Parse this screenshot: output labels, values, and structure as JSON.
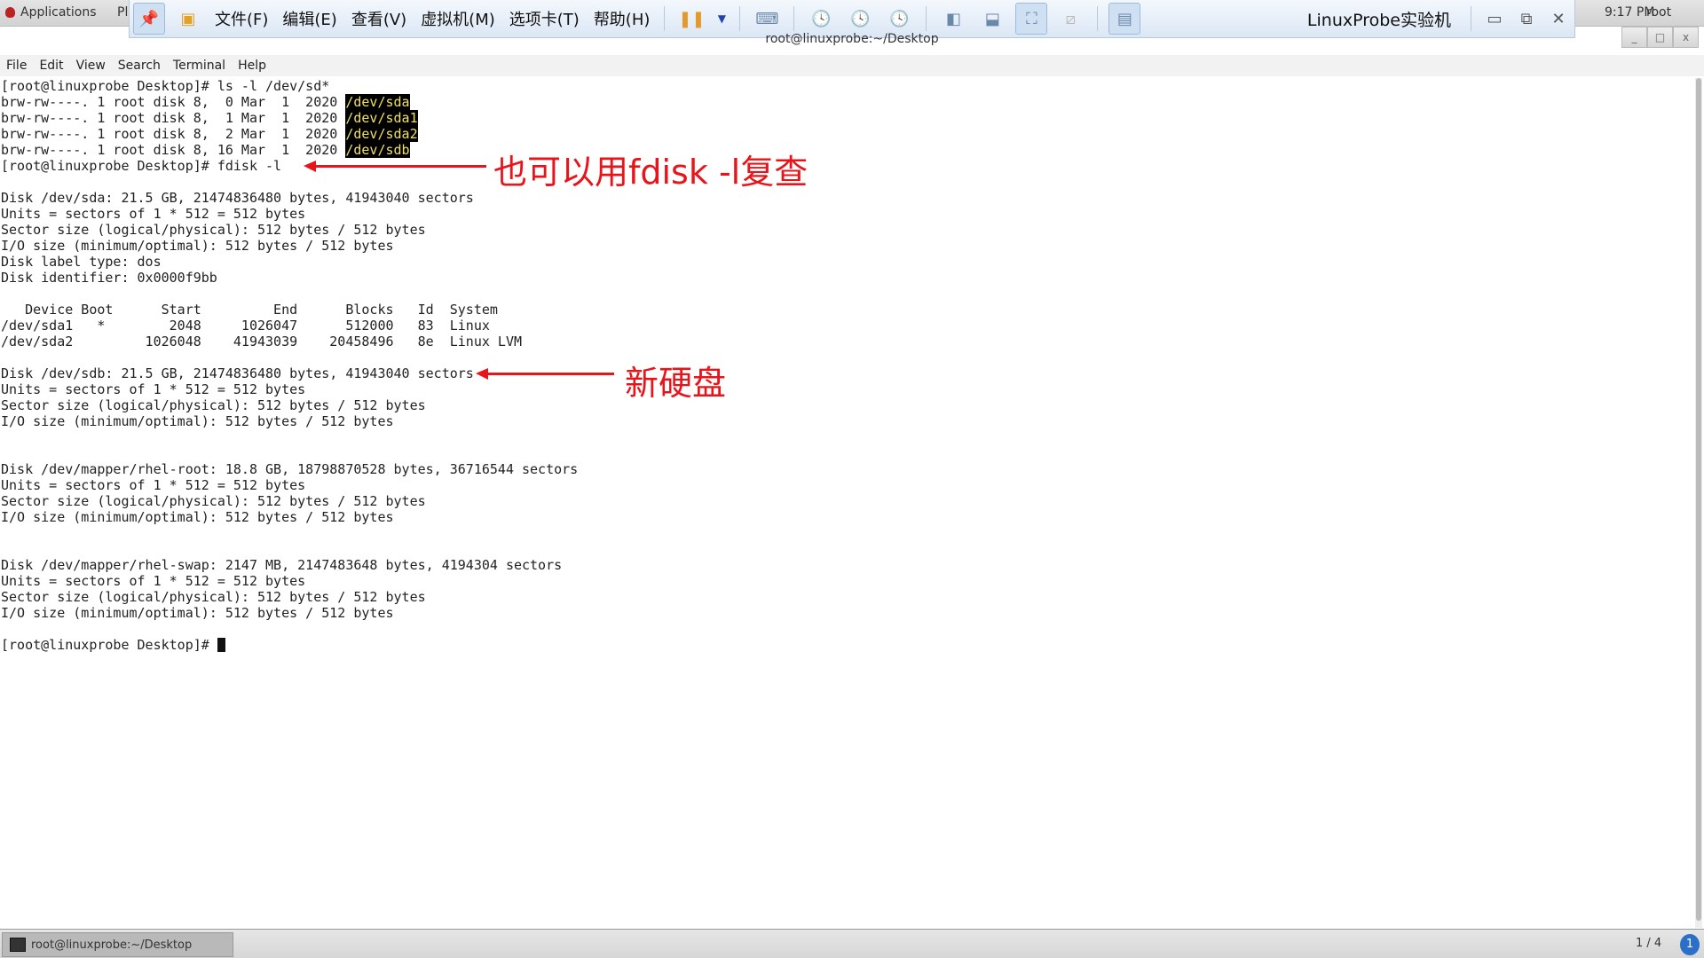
{
  "topbar": {
    "applications": "Applications",
    "places": "Pl",
    "clock": "9:17 PM",
    "user": "root"
  },
  "vmware": {
    "menus": [
      "文件(F)",
      "编辑(E)",
      "查看(V)",
      "虚拟机(M)",
      "选项卡(T)",
      "帮助(H)"
    ],
    "title": "LinuxProbe实验机",
    "icons": [
      "pin-icon",
      "vm-library-icon",
      "pause-icon",
      "dropdown-icon",
      "send-ctrl-alt-del-icon",
      "snapshot-take-icon",
      "snapshot-revert-icon",
      "snapshot-manager-icon",
      "console-view-icon",
      "thumbnail-view-icon",
      "fullscreen-icon",
      "unity-icon",
      "view-toggle-icon"
    ]
  },
  "window": {
    "title": "root@linuxprobe:~/Desktop",
    "menu": [
      "File",
      "Edit",
      "View",
      "Search",
      "Terminal",
      "Help"
    ]
  },
  "terminal": {
    "lines": [
      {
        "t": "[root@linuxprobe Desktop]# ls -l /dev/sd*"
      },
      {
        "t": "brw-rw----. 1 root disk 8,  0 Mar  1  2020 ",
        "h": "/dev/sda"
      },
      {
        "t": "brw-rw----. 1 root disk 8,  1 Mar  1  2020 ",
        "h": "/dev/sda1"
      },
      {
        "t": "brw-rw----. 1 root disk 8,  2 Mar  1  2020 ",
        "h": "/dev/sda2"
      },
      {
        "t": "brw-rw----. 1 root disk 8, 16 Mar  1  2020 ",
        "h": "/dev/sdb"
      },
      {
        "t": "[root@linuxprobe Desktop]# fdisk -l"
      },
      {
        "t": ""
      },
      {
        "t": "Disk /dev/sda: 21.5 GB, 21474836480 bytes, 41943040 sectors"
      },
      {
        "t": "Units = sectors of 1 * 512 = 512 bytes"
      },
      {
        "t": "Sector size (logical/physical): 512 bytes / 512 bytes"
      },
      {
        "t": "I/O size (minimum/optimal): 512 bytes / 512 bytes"
      },
      {
        "t": "Disk label type: dos"
      },
      {
        "t": "Disk identifier: 0x0000f9bb"
      },
      {
        "t": ""
      },
      {
        "t": "   Device Boot      Start         End      Blocks   Id  System"
      },
      {
        "t": "/dev/sda1   *        2048     1026047      512000   83  Linux"
      },
      {
        "t": "/dev/sda2         1026048    41943039    20458496   8e  Linux LVM"
      },
      {
        "t": ""
      },
      {
        "t": "Disk /dev/sdb: 21.5 GB, 21474836480 bytes, 41943040 sectors"
      },
      {
        "t": "Units = sectors of 1 * 512 = 512 bytes"
      },
      {
        "t": "Sector size (logical/physical): 512 bytes / 512 bytes"
      },
      {
        "t": "I/O size (minimum/optimal): 512 bytes / 512 bytes"
      },
      {
        "t": ""
      },
      {
        "t": ""
      },
      {
        "t": "Disk /dev/mapper/rhel-root: 18.8 GB, 18798870528 bytes, 36716544 sectors"
      },
      {
        "t": "Units = sectors of 1 * 512 = 512 bytes"
      },
      {
        "t": "Sector size (logical/physical): 512 bytes / 512 bytes"
      },
      {
        "t": "I/O size (minimum/optimal): 512 bytes / 512 bytes"
      },
      {
        "t": ""
      },
      {
        "t": ""
      },
      {
        "t": "Disk /dev/mapper/rhel-swap: 2147 MB, 2147483648 bytes, 4194304 sectors"
      },
      {
        "t": "Units = sectors of 1 * 512 = 512 bytes"
      },
      {
        "t": "Sector size (logical/physical): 512 bytes / 512 bytes"
      },
      {
        "t": "I/O size (minimum/optimal): 512 bytes / 512 bytes"
      },
      {
        "t": ""
      },
      {
        "t": "[root@linuxprobe Desktop]# ",
        "cursor": true
      }
    ]
  },
  "annotations": {
    "fdisk_note": "也可以用fdisk -l复查",
    "new_disk_note": "新硬盘",
    "color": "#e8141a"
  },
  "taskbar": {
    "window_button": "root@linuxprobe:~/Desktop",
    "workspace": "1 / 4",
    "indicator": "1"
  }
}
